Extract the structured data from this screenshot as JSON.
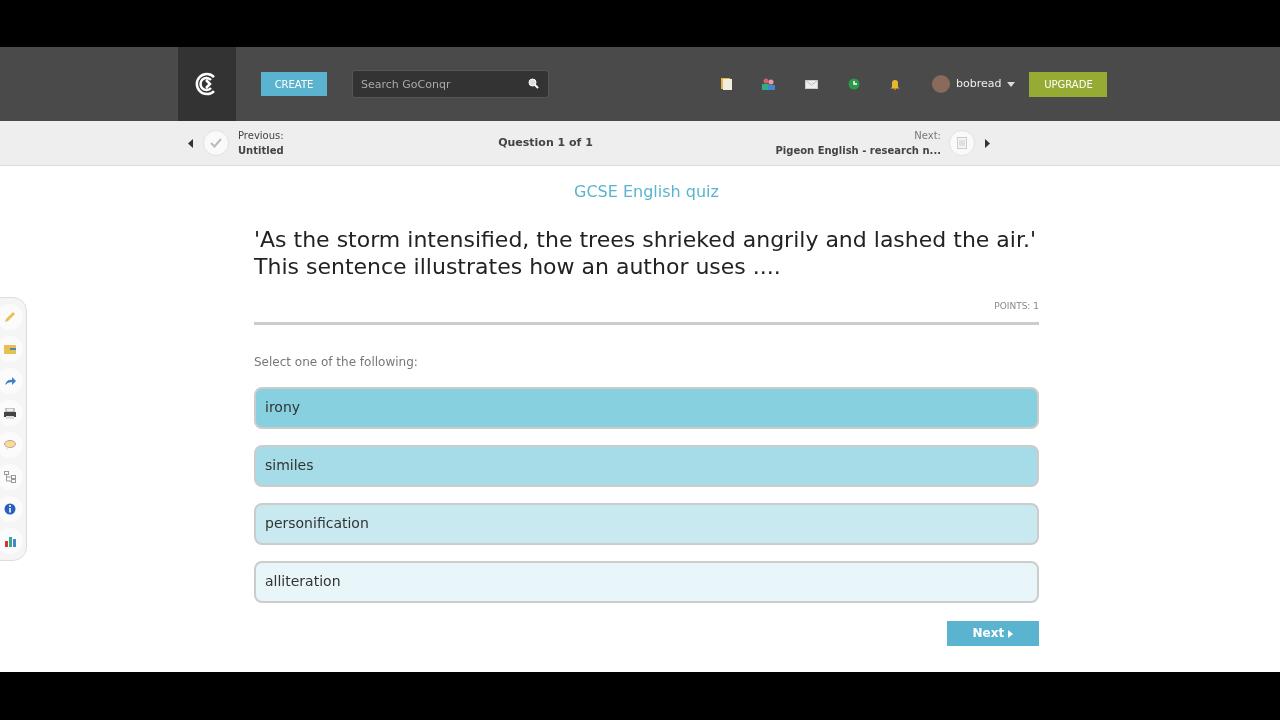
{
  "header": {
    "create_button": "CREATE",
    "search": {
      "placeholder": "Search GoConqr"
    },
    "user": {
      "name": "bobread"
    },
    "upgrade_button": "UPGRADE"
  },
  "question_nav": {
    "previous": {
      "label": "Previous:",
      "title": "Untitled"
    },
    "counter": "Question 1 of 1",
    "next": {
      "label": "Next:",
      "title": "Pigeon English - research n..."
    }
  },
  "quiz": {
    "title": "GCSE English quiz",
    "question": "'As the storm intensified, the trees shrieked angrily and lashed the air.'\nThis sentence illustrates how an author uses ....",
    "points": "POINTS: 1",
    "instruction": "Select one of the following:",
    "options": [
      {
        "label": "irony",
        "color": "#86d0e0"
      },
      {
        "label": "similes",
        "color": "#a6dce8"
      },
      {
        "label": "personification",
        "color": "#c8e9f0"
      },
      {
        "label": "alliteration",
        "color": "#e9f6f9"
      }
    ],
    "next_button": "Next"
  }
}
